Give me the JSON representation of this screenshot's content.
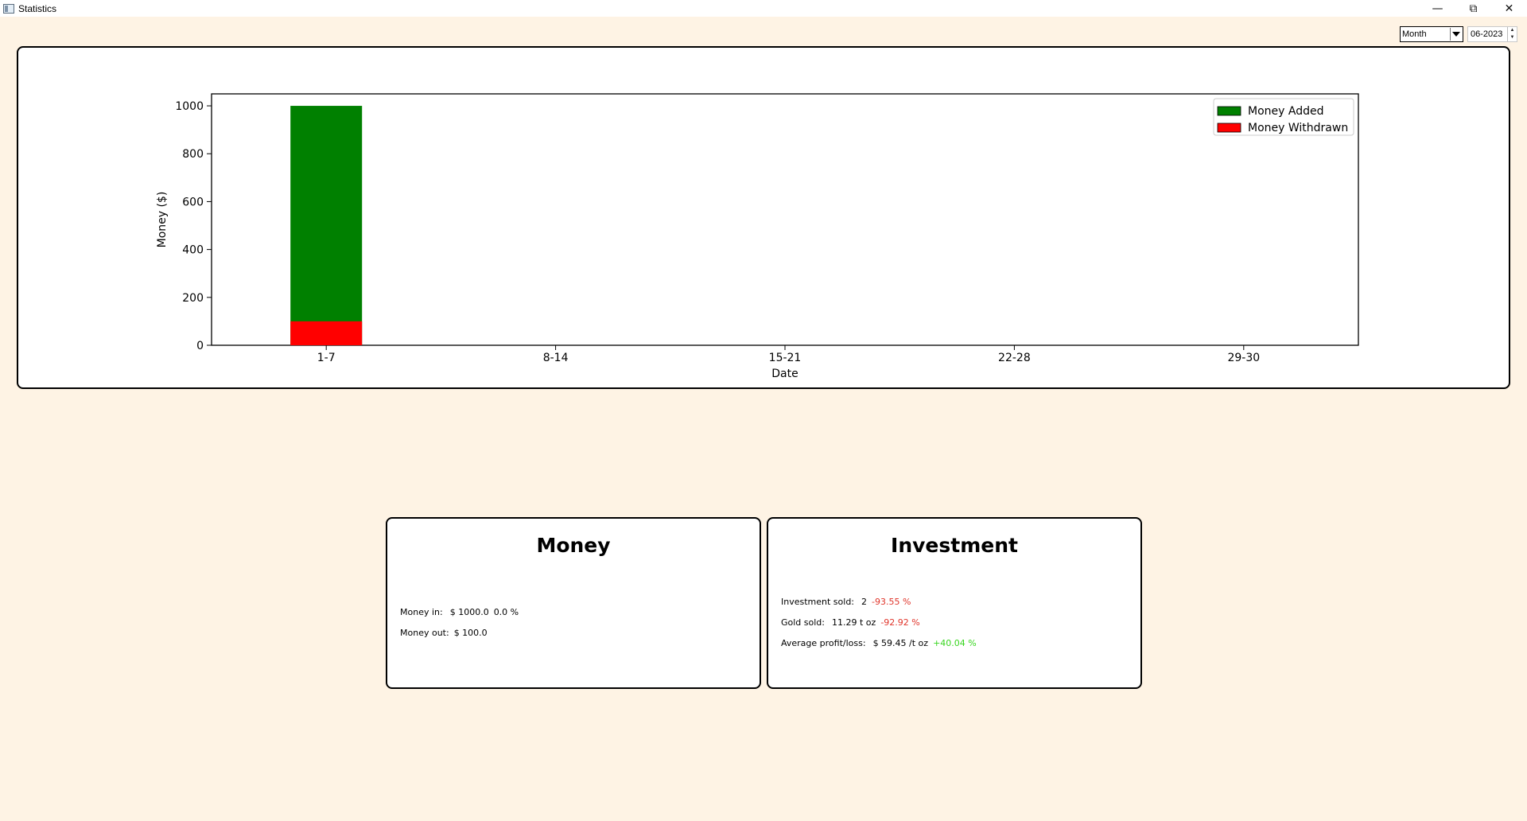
{
  "window": {
    "title": "Statistics",
    "controls": [
      "minimize-icon",
      "restore-icon",
      "close-icon"
    ]
  },
  "filters": {
    "period_selected": "Month",
    "date_value": "06-2023"
  },
  "chart_data": {
    "type": "bar",
    "stacked": true,
    "categories": [
      "1-7",
      "8-14",
      "15-21",
      "22-28",
      "29-30"
    ],
    "series": [
      {
        "name": "Money Added",
        "values": [
          1000,
          0,
          0,
          0,
          0
        ],
        "color": "#008000"
      },
      {
        "name": "Money Withdrawn",
        "values": [
          100,
          0,
          0,
          0,
          0
        ],
        "color": "#ff0000"
      }
    ],
    "xlabel": "Date",
    "ylabel": "Money ($)",
    "ylim": [
      0,
      1050
    ],
    "yticks": [
      "0",
      "200",
      "400",
      "600",
      "800",
      "1000"
    ],
    "legend_position": "top-right",
    "grid": false
  },
  "money_card": {
    "title": "Money",
    "money_in_label": "Money in:",
    "money_in_value": "$ 1000.0",
    "money_in_change": "0.0 %",
    "money_out_label": "Money out:",
    "money_out_value": "$ 100.0"
  },
  "investment_card": {
    "title": "Investment",
    "investment_sold_label": "Investment sold:",
    "investment_sold_value": "2",
    "investment_sold_change": "-93.55 %",
    "gold_sold_label": "Gold sold:",
    "gold_sold_value": "11.29 t oz",
    "gold_sold_change": "-92.92 %",
    "avg_profit_label": "Average profit/loss:",
    "avg_profit_value": "$ 59.45 /t oz",
    "avg_profit_change": "+40.04 %"
  },
  "colors": {
    "background": "#fef3e4",
    "positive": "#37d51e",
    "negative": "#e0342a"
  }
}
